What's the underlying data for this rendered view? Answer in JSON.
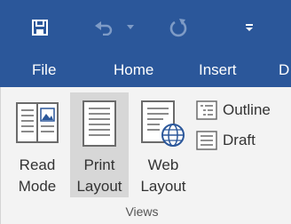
{
  "colors": {
    "titlebar": "#2b579a",
    "ribbon": "#f3f3f3",
    "active_button": "#d7d7d7",
    "icon_blue": "#2b579a"
  },
  "qat": {
    "save_icon": "save-icon",
    "undo_icon": "undo-icon",
    "undo_dropdown_icon": "chevron-down-icon",
    "redo_icon": "redo-icon",
    "customize_icon": "customize-qat-icon"
  },
  "tabs": [
    {
      "label": "File"
    },
    {
      "label": "Home"
    },
    {
      "label": "Insert"
    },
    {
      "label": "D"
    }
  ],
  "views_group": {
    "label": "Views",
    "buttons": [
      {
        "line1": "Read",
        "line2": "Mode",
        "icon": "read-mode-icon",
        "active": false
      },
      {
        "line1": "Print",
        "line2": "Layout",
        "icon": "print-layout-icon",
        "active": true
      },
      {
        "line1": "Web",
        "line2": "Layout",
        "icon": "web-layout-icon",
        "active": false
      }
    ],
    "small_buttons": [
      {
        "label": "Outline",
        "icon": "outline-icon"
      },
      {
        "label": "Draft",
        "icon": "draft-icon"
      }
    ]
  }
}
